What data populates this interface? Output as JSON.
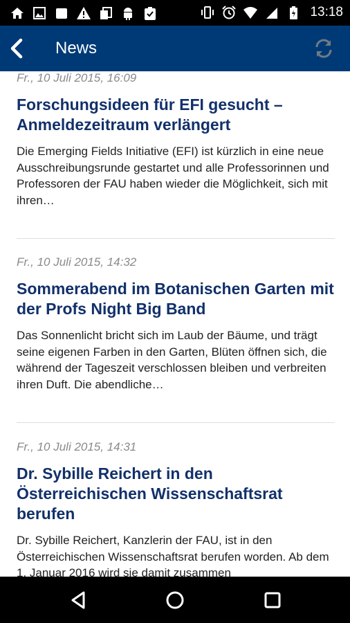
{
  "status_bar": {
    "time": "13:18",
    "left_icons": [
      "home-icon",
      "image-icon",
      "square-icon",
      "warning-icon",
      "copy-icon",
      "android-icon",
      "clipboard-check-icon"
    ],
    "right_icons": [
      "vibrate-icon",
      "alarm-icon",
      "wifi-icon",
      "signal-icon",
      "battery-charging-icon"
    ]
  },
  "app_bar": {
    "title": "News",
    "background": "#003a76",
    "refresh_color": "#6f7b86"
  },
  "articles": [
    {
      "date": "Fr., 10 Juli 2015, 16:09",
      "headline": "Forschungsideen für EFI gesucht – Anmeldezeitraum verlängert",
      "teaser": "Die Emerging Fields Initiative (EFI) ist kürzlich in eine neue Ausschreibungsrunde gestartet und alle Professorinnen und Professoren der FAU haben wieder die Möglichkeit, sich mit ihren…"
    },
    {
      "date": "Fr., 10 Juli 2015, 14:32",
      "headline": "Sommerabend im Botanischen Garten mit der Profs Night Big Band",
      "teaser": "Das Sonnenlicht bricht sich im Laub der Bäume, und trägt seine eigenen Farben in den Garten, Blüten öffnen sich, die während der Tageszeit verschlossen bleiben und verbreiten ihren Duft. Die abendliche…"
    },
    {
      "date": "Fr., 10 Juli 2015, 14:31",
      "headline": "Dr. Sybille Reichert in den Österreichischen Wissenschaftsrat berufen",
      "teaser": "Dr. Sybille Reichert, Kanzlerin der FAU, ist in den Österreichischen Wissenschaftsrat berufen worden. Ab dem 1. Januar 2016 wird sie damit zusammen"
    }
  ],
  "colors": {
    "headline": "#12306a",
    "date": "#8a8a8a",
    "teaser": "#222222"
  }
}
